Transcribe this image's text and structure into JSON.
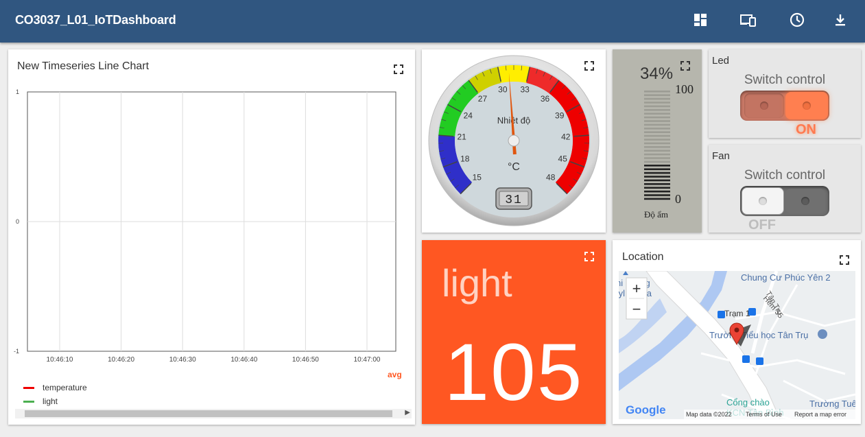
{
  "header": {
    "title": "CO3037_L01_IoTDashboard"
  },
  "toolbar": {
    "layouts_icon": "dashboard-icon",
    "devices_icon": "devices-icon",
    "history_icon": "clock-icon",
    "export_icon": "download-icon"
  },
  "chart_widget": {
    "title": "New Timeseries Line Chart",
    "aggregation": "avg",
    "chart_data": {
      "type": "line",
      "x": [
        "10:46:10",
        "10:46:20",
        "10:46:30",
        "10:46:40",
        "10:46:50",
        "10:47:00"
      ],
      "ytick_labels": [
        "1",
        "0",
        "-1"
      ],
      "ylim": [
        -1,
        1
      ],
      "series": [
        {
          "name": "temperature",
          "color": "#ef0000",
          "values": []
        },
        {
          "name": "light",
          "color": "#4caf50",
          "values": []
        }
      ]
    }
  },
  "gauge_widget": {
    "label": "Nhiệt độ",
    "unit": "°C",
    "value": 31,
    "display": "31",
    "ticks": [
      "15",
      "18",
      "21",
      "24",
      "27",
      "30",
      "33",
      "36",
      "39",
      "42",
      "45",
      "48"
    ],
    "range": [
      15,
      48
    ]
  },
  "humidity_widget": {
    "percent_text": "34%",
    "value": 34,
    "max_label": "100",
    "min_label": "0",
    "label": "Độ ẩm"
  },
  "led_widget": {
    "title": "Led",
    "control_title": "Switch control",
    "state": "ON",
    "on": true
  },
  "fan_widget": {
    "title": "Fan",
    "control_title": "Switch control",
    "state": "OFF",
    "on": false
  },
  "light_widget": {
    "label": "light",
    "value": "105",
    "color": "#ff5722"
  },
  "map_widget": {
    "title": "Location",
    "zoom_in": "+",
    "zoom_out": "−",
    "labels": {
      "top_left_1": "hi rường",
      "top_left_2": "tyl Media",
      "apartment": "Chung Cư Phúc Yên 2",
      "street1": "Tân Trụ",
      "street2": "Hẻm 55",
      "station": "Trạm 1",
      "school": "Trường Tiểu học Tân Trụ",
      "gate1": "Cổng chào",
      "gate2": "KCN Tân Bình",
      "school2": "Trường Tuế"
    },
    "attribution": [
      "Map data ©2022",
      "Terms of Use",
      "Report a map error"
    ],
    "logo": "Google"
  }
}
